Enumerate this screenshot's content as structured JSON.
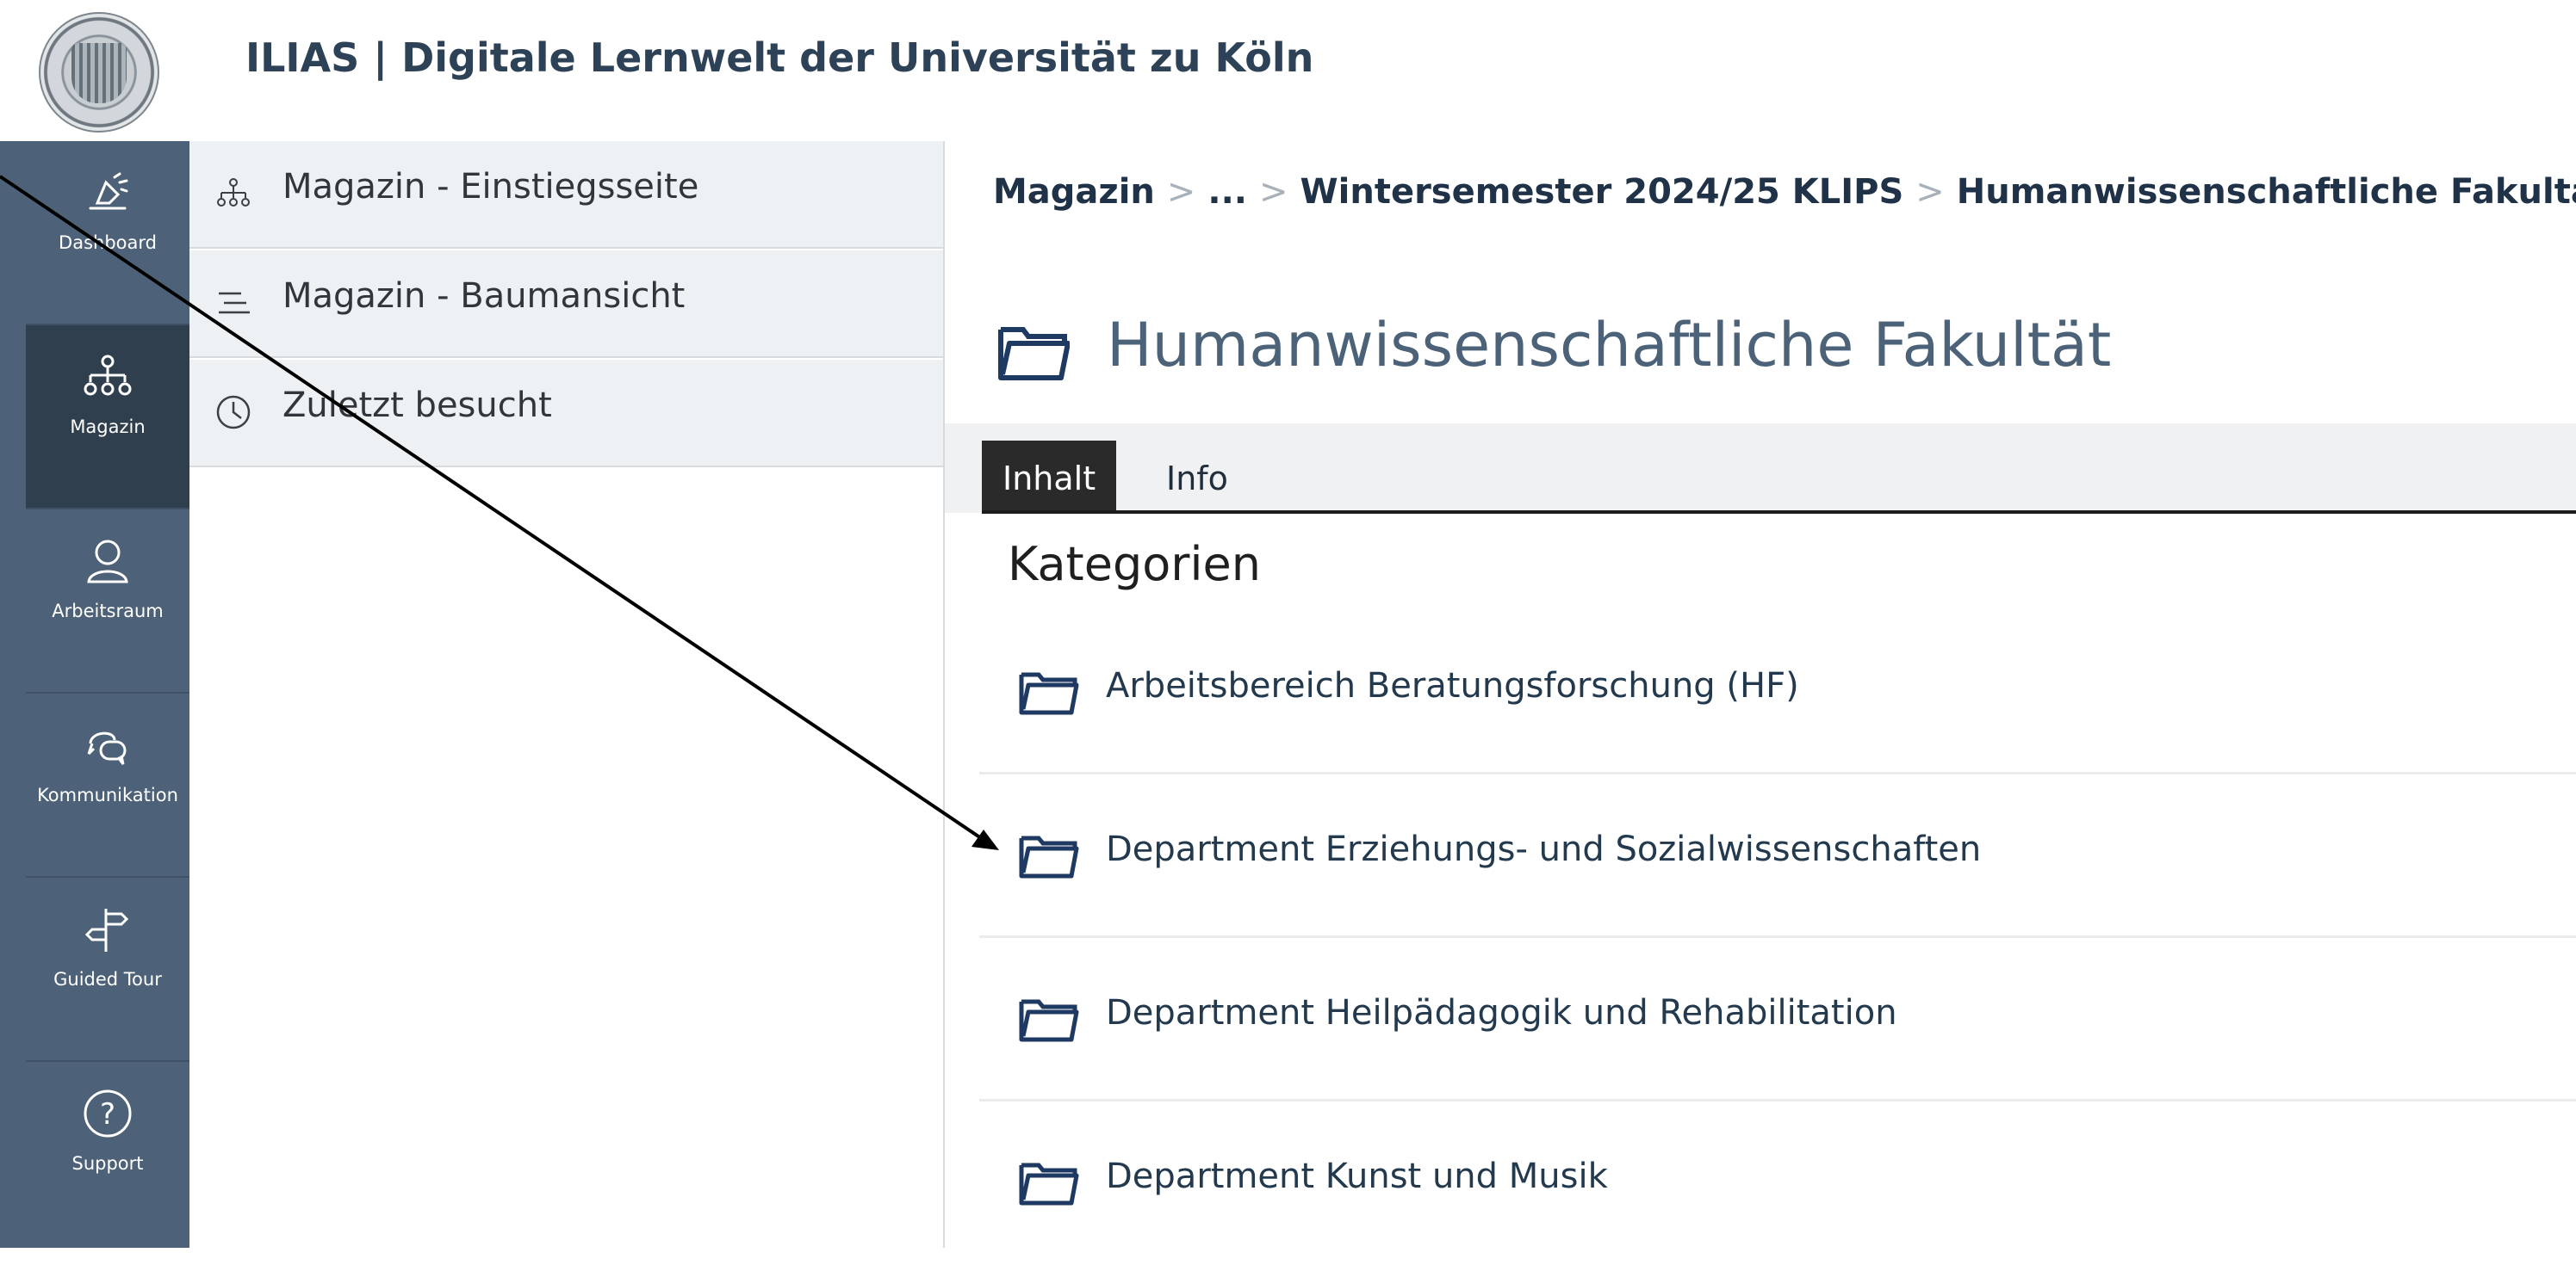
{
  "header": {
    "title": "ILIAS | Digitale Lernwelt der Universität zu Köln"
  },
  "mainbar": {
    "items": [
      {
        "label": "Dashboard",
        "icon": "dashboard-icon"
      },
      {
        "label": "Magazin",
        "icon": "magazin-icon",
        "active": true
      },
      {
        "label": "Arbeitsraum",
        "icon": "user-icon"
      },
      {
        "label": "Kommunikation",
        "icon": "chat-icon"
      },
      {
        "label": "Guided Tour",
        "icon": "signpost-icon"
      },
      {
        "label": "Support",
        "icon": "help-icon"
      }
    ]
  },
  "slate": {
    "items": [
      {
        "label": "Magazin - Einstiegsseite",
        "icon": "sitemap-icon"
      },
      {
        "label": "Magazin - Baumansicht",
        "icon": "tree-list-icon"
      },
      {
        "label": "Zuletzt besucht",
        "icon": "clock-icon"
      }
    ]
  },
  "breadcrumb": {
    "items": [
      "Magazin",
      "...",
      "Wintersemester 2024/25 KLIPS",
      "Humanwissenschaftliche Fakultät"
    ],
    "separator": ">"
  },
  "page": {
    "title": "Humanwissenschaftliche Fakultät"
  },
  "tabs": [
    {
      "label": "Inhalt",
      "active": true
    },
    {
      "label": "Info",
      "active": false
    }
  ],
  "section": {
    "title": "Kategorien"
  },
  "categories": [
    {
      "label": "Arbeitsbereich Beratungsforschung (HF)"
    },
    {
      "label": "Department Erziehungs- und Sozialwissenschaften"
    },
    {
      "label": "Department Heilpädagogik und Rehabilitation"
    },
    {
      "label": "Department Kunst und Musik"
    }
  ],
  "colors": {
    "mainbar": "#4d6278",
    "mainbar_active": "#2f3f4e",
    "title": "#2d4256",
    "folder": "#1f3a62"
  }
}
